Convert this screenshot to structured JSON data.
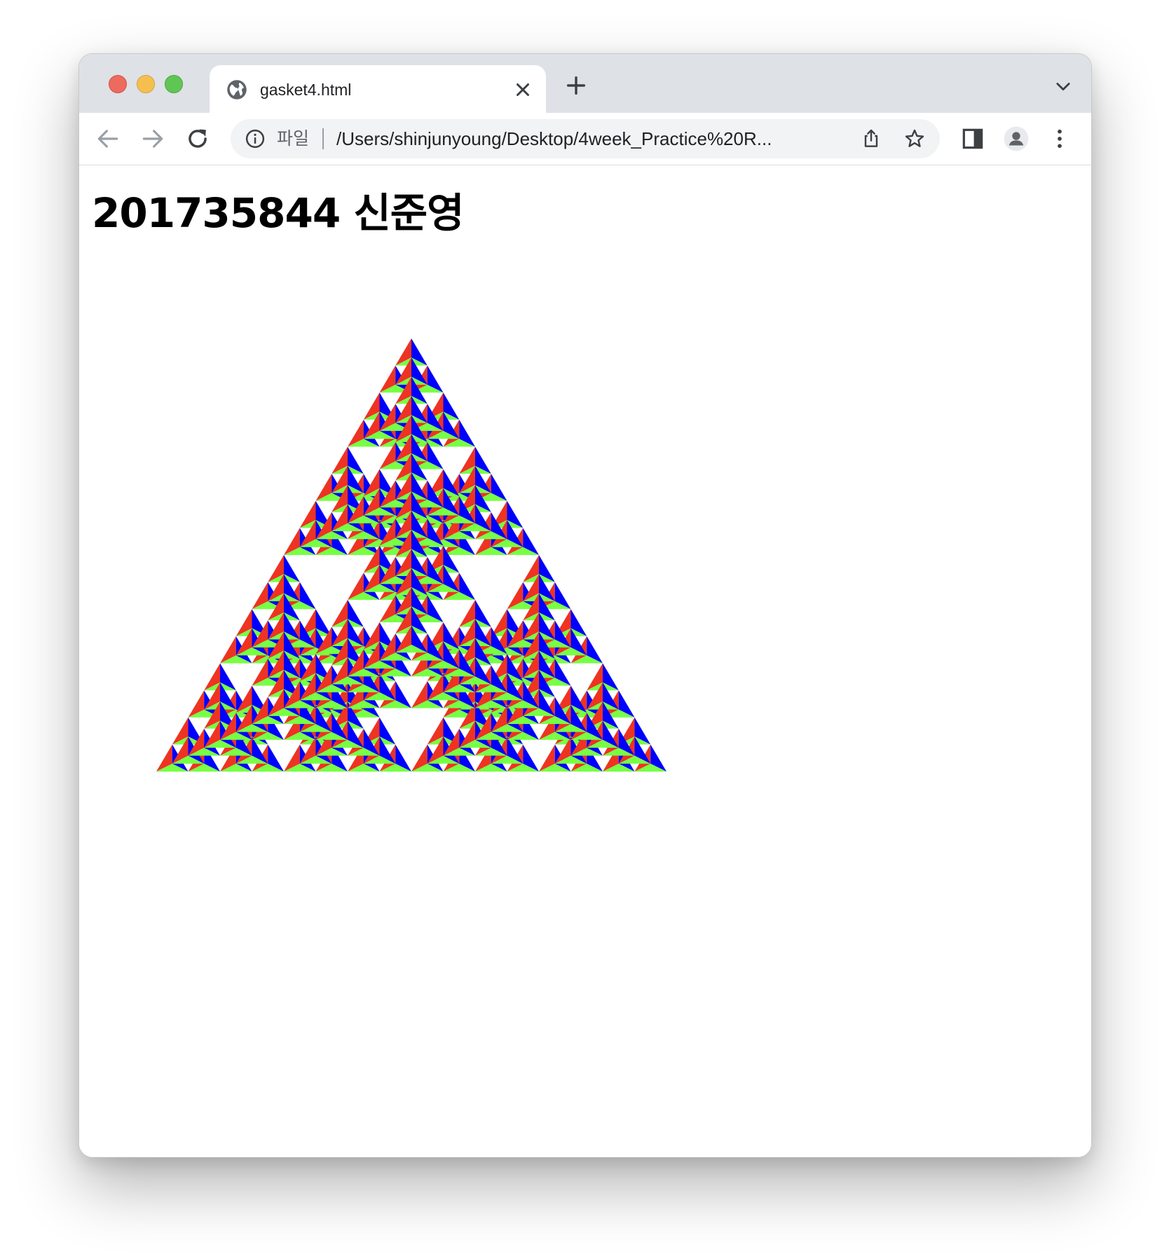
{
  "browser": {
    "tab": {
      "title": "gasket4.html",
      "favicon": "globe-icon"
    },
    "omnibox": {
      "scheme_label": "파일",
      "url": "/Users/shinjunyoung/Desktop/4week_Practice%20R..."
    },
    "icons": {
      "back": "arrow-left-icon",
      "forward": "arrow-right-icon",
      "reload": "reload-icon",
      "info": "info-icon",
      "share": "share-icon",
      "bookmark": "star-icon",
      "side_panel": "side-panel-icon",
      "profile": "avatar-icon",
      "menu": "kebab-menu-icon",
      "new_tab": "plus-icon",
      "tab_search": "chevron-down-icon",
      "tab_close": "close-icon"
    }
  },
  "page": {
    "heading": "201735844 신준영",
    "gasket": {
      "subdivision_depth": 4,
      "colors": {
        "red": "#ee3322",
        "blue": "#0000ff",
        "green": "#77ff44",
        "background": "#ffffff"
      }
    }
  }
}
